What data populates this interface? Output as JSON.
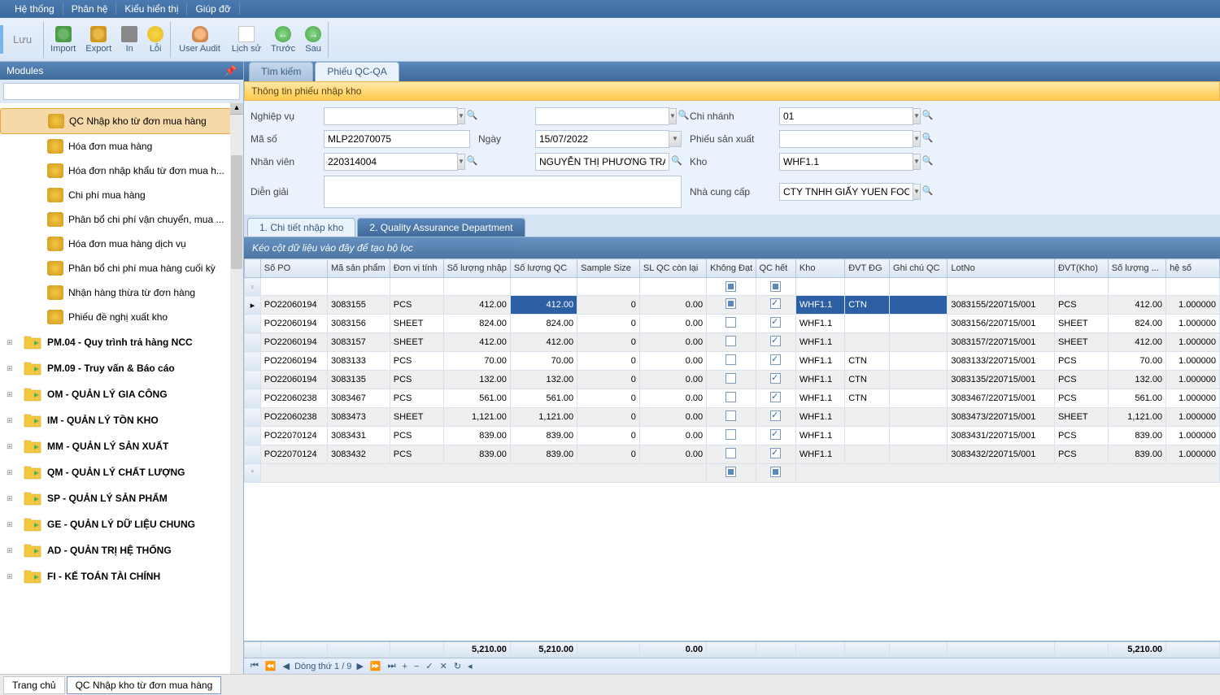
{
  "menubar": [
    "Hệ thống",
    "Phân hệ",
    "Kiểu hiển thị",
    "Giúp đỡ"
  ],
  "toolbar": {
    "luu": "Lưu",
    "import": "Import",
    "export": "Export",
    "in": "In",
    "loi": "Lỗi",
    "userAudit": "User Audit",
    "lichSu": "Lịch sử",
    "truoc": "Trước",
    "sau": "Sau"
  },
  "sidebar": {
    "title": "Modules",
    "items": [
      {
        "label": "QC Nhập kho từ đơn mua hàng",
        "selected": true,
        "leaf": true
      },
      {
        "label": "Hóa đơn mua hàng",
        "leaf": true
      },
      {
        "label": "Hóa đơn nhập khẩu từ đơn mua h...",
        "leaf": true
      },
      {
        "label": "Chi phí mua hàng",
        "leaf": true
      },
      {
        "label": "Phân bổ chi phí vận chuyển, mua ...",
        "leaf": true
      },
      {
        "label": "Hóa đơn mua hàng dịch vụ",
        "leaf": true
      },
      {
        "label": "Phân bổ chi phí mua hàng cuối kỳ",
        "leaf": true
      },
      {
        "label": "Nhận hàng thừa từ đơn hàng",
        "leaf": true
      },
      {
        "label": "Phiếu đề nghị xuất kho",
        "leaf": true
      },
      {
        "label": "PM.04 - Quy trình trả hàng NCC",
        "bold": true,
        "expander": "+"
      },
      {
        "label": "PM.09 - Truy vấn & Báo cáo",
        "bold": true,
        "expander": "+"
      },
      {
        "label": "OM - QUẢN LÝ GIA CÔNG",
        "bold": true,
        "expander": "+"
      },
      {
        "label": "IM - QUẢN LÝ TỒN KHO",
        "bold": true,
        "expander": "+"
      },
      {
        "label": "MM - QUẢN LÝ SẢN XUẤT",
        "bold": true,
        "expander": "+"
      },
      {
        "label": "QM - QUẢN LÝ CHẤT LƯỢNG",
        "bold": true,
        "expander": "+"
      },
      {
        "label": "SP - QUẢN LÝ SẢN PHẨM",
        "bold": true,
        "expander": "+"
      },
      {
        "label": "GE - QUẢN LÝ DỮ LIỆU CHUNG",
        "bold": true,
        "expander": "+"
      },
      {
        "label": "AD - QUẢN TRỊ HỆ THỐNG",
        "bold": true,
        "expander": "+"
      },
      {
        "label": "FI - KẾ TOÁN TÀI CHÍNH",
        "bold": true,
        "expander": "+"
      }
    ]
  },
  "tabs": [
    {
      "label": "Tìm kiếm",
      "active": false
    },
    {
      "label": "Phiếu QC-QA",
      "active": true
    }
  ],
  "panelTitle": "Thông tin phiếu nhập kho",
  "form": {
    "nghiepVu": {
      "label": "Nghiệp vụ",
      "value": ""
    },
    "chiNhanh": {
      "label": "Chi nhánh",
      "value": "01"
    },
    "maSo": {
      "label": "Mã số",
      "value": "MLP22070075"
    },
    "ngay": {
      "label": "Ngày",
      "value": "15/07/2022"
    },
    "phieuSanXuat": {
      "label": "Phiếu sản xuất",
      "value": ""
    },
    "nhanVien": {
      "label": "Nhân viên",
      "value": "220314004",
      "value2": "NGUYỄN THỊ PHƯƠNG TRANG"
    },
    "kho": {
      "label": "Kho",
      "value": "WHF1.1"
    },
    "dienGiai": {
      "label": "Diễn giải",
      "value": ""
    },
    "nhaCungCap": {
      "label": "Nhà cung cấp",
      "value": "CTY TNHH GIẤY YUEN FOONG"
    }
  },
  "subtabs": [
    {
      "label": "1. Chi tiết nhập kho",
      "active": false
    },
    {
      "label": "2. Quality Assurance Department",
      "active": true
    }
  ],
  "groupByHint": "Kéo cột dữ liệu vào đây để tạo bộ lọc",
  "grid": {
    "columns": [
      "Số PO",
      "Mã sản phẩm",
      "Đơn vị tính",
      "Số lượng nhập",
      "Số lượng QC",
      "Sample Size",
      "SL QC còn lại",
      "Không Đạt",
      "QC hết",
      "Kho",
      "ĐVT ĐG",
      "Ghi chú QC",
      "LotNo",
      "ĐVT(Kho)",
      "Số lượng ...",
      "hệ số"
    ],
    "rows": [
      {
        "po": "PO22060194",
        "msp": "3083155",
        "dvt": "PCS",
        "sln": "412.00",
        "slqc": "412.00",
        "ss": "0",
        "slcl": "0.00",
        "kd": "ind",
        "qh": true,
        "kho": "WHF1.1",
        "dvtdg": "CTN",
        "gc": "",
        "lot": "3083155/220715/001",
        "dvtkho": "PCS",
        "sl": "412.00",
        "hs": "1.000000",
        "sel": true
      },
      {
        "po": "PO22060194",
        "msp": "3083156",
        "dvt": "SHEET",
        "sln": "824.00",
        "slqc": "824.00",
        "ss": "0",
        "slcl": "0.00",
        "kd": false,
        "qh": true,
        "kho": "WHF1.1",
        "dvtdg": "",
        "gc": "",
        "lot": "3083156/220715/001",
        "dvtkho": "SHEET",
        "sl": "824.00",
        "hs": "1.000000"
      },
      {
        "po": "PO22060194",
        "msp": "3083157",
        "dvt": "SHEET",
        "sln": "412.00",
        "slqc": "412.00",
        "ss": "0",
        "slcl": "0.00",
        "kd": false,
        "qh": true,
        "kho": "WHF1.1",
        "dvtdg": "",
        "gc": "",
        "lot": "3083157/220715/001",
        "dvtkho": "SHEET",
        "sl": "412.00",
        "hs": "1.000000"
      },
      {
        "po": "PO22060194",
        "msp": "3083133",
        "dvt": "PCS",
        "sln": "70.00",
        "slqc": "70.00",
        "ss": "0",
        "slcl": "0.00",
        "kd": false,
        "qh": true,
        "kho": "WHF1.1",
        "dvtdg": "CTN",
        "gc": "",
        "lot": "3083133/220715/001",
        "dvtkho": "PCS",
        "sl": "70.00",
        "hs": "1.000000"
      },
      {
        "po": "PO22060194",
        "msp": "3083135",
        "dvt": "PCS",
        "sln": "132.00",
        "slqc": "132.00",
        "ss": "0",
        "slcl": "0.00",
        "kd": false,
        "qh": true,
        "kho": "WHF1.1",
        "dvtdg": "CTN",
        "gc": "",
        "lot": "3083135/220715/001",
        "dvtkho": "PCS",
        "sl": "132.00",
        "hs": "1.000000"
      },
      {
        "po": "PO22060238",
        "msp": "3083467",
        "dvt": "PCS",
        "sln": "561.00",
        "slqc": "561.00",
        "ss": "0",
        "slcl": "0.00",
        "kd": false,
        "qh": true,
        "kho": "WHF1.1",
        "dvtdg": "CTN",
        "gc": "",
        "lot": "3083467/220715/001",
        "dvtkho": "PCS",
        "sl": "561.00",
        "hs": "1.000000"
      },
      {
        "po": "PO22060238",
        "msp": "3083473",
        "dvt": "SHEET",
        "sln": "1,121.00",
        "slqc": "1,121.00",
        "ss": "0",
        "slcl": "0.00",
        "kd": false,
        "qh": true,
        "kho": "WHF1.1",
        "dvtdg": "",
        "gc": "",
        "lot": "3083473/220715/001",
        "dvtkho": "SHEET",
        "sl": "1,121.00",
        "hs": "1.000000"
      },
      {
        "po": "PO22070124",
        "msp": "3083431",
        "dvt": "PCS",
        "sln": "839.00",
        "slqc": "839.00",
        "ss": "0",
        "slcl": "0.00",
        "kd": false,
        "qh": true,
        "kho": "WHF1.1",
        "dvtdg": "",
        "gc": "",
        "lot": "3083431/220715/001",
        "dvtkho": "PCS",
        "sl": "839.00",
        "hs": "1.000000"
      },
      {
        "po": "PO22070124",
        "msp": "3083432",
        "dvt": "PCS",
        "sln": "839.00",
        "slqc": "839.00",
        "ss": "0",
        "slcl": "0.00",
        "kd": false,
        "qh": true,
        "kho": "WHF1.1",
        "dvtdg": "",
        "gc": "",
        "lot": "3083432/220715/001",
        "dvtkho": "PCS",
        "sl": "839.00",
        "hs": "1.000000"
      }
    ],
    "totals": {
      "sln": "5,210.00",
      "slqc": "5,210.00",
      "slcl": "0.00",
      "sl": "5,210.00"
    }
  },
  "pager": "Dòng thứ 1 / 9",
  "statusbar": {
    "home": "Trang chủ",
    "current": "QC Nhập kho từ đơn mua hàng"
  }
}
